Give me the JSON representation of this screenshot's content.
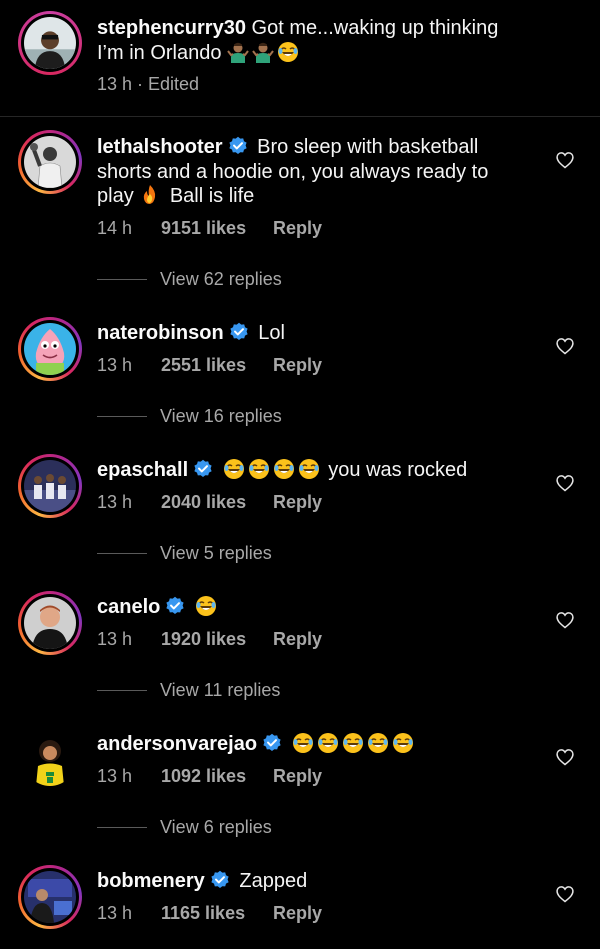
{
  "caption": {
    "username": "stephencurry30",
    "text": "Got me...waking up thinking I’m in Orlando",
    "meta": "13 h · Edited",
    "emojis": [
      "shrug-man-icon",
      "shrug-man-icon",
      "laughing-icon"
    ]
  },
  "comments": [
    {
      "username": "lethalshooter",
      "text": "Bro sleep with basketball shorts and a hoodie on, you always ready to play",
      "text2": "Ball is life",
      "time": "14 h",
      "likes": "9151 likes",
      "reply": "Reply",
      "view_replies": "View 62 replies"
    },
    {
      "username": "naterobinson",
      "text": "Lol",
      "time": "13 h",
      "likes": "2551 likes",
      "reply": "Reply",
      "view_replies": "View 16 replies"
    },
    {
      "username": "epaschall",
      "text": "you was rocked",
      "time": "13 h",
      "likes": "2040 likes",
      "reply": "Reply",
      "view_replies": "View 5 replies"
    },
    {
      "username": "canelo",
      "text": "",
      "time": "13 h",
      "likes": "1920 likes",
      "reply": "Reply",
      "view_replies": "View 11 replies"
    },
    {
      "username": "andersonvarejao",
      "text": "",
      "time": "13 h",
      "likes": "1092 likes",
      "reply": "Reply",
      "view_replies": "View 6 replies"
    },
    {
      "username": "bobmenery",
      "text": "Zapped",
      "time": "13 h",
      "likes": "1165 likes",
      "reply": "Reply"
    }
  ],
  "colors": {
    "background": "#000000",
    "verified": "#3897f0",
    "muted": "#a8a8a8"
  }
}
